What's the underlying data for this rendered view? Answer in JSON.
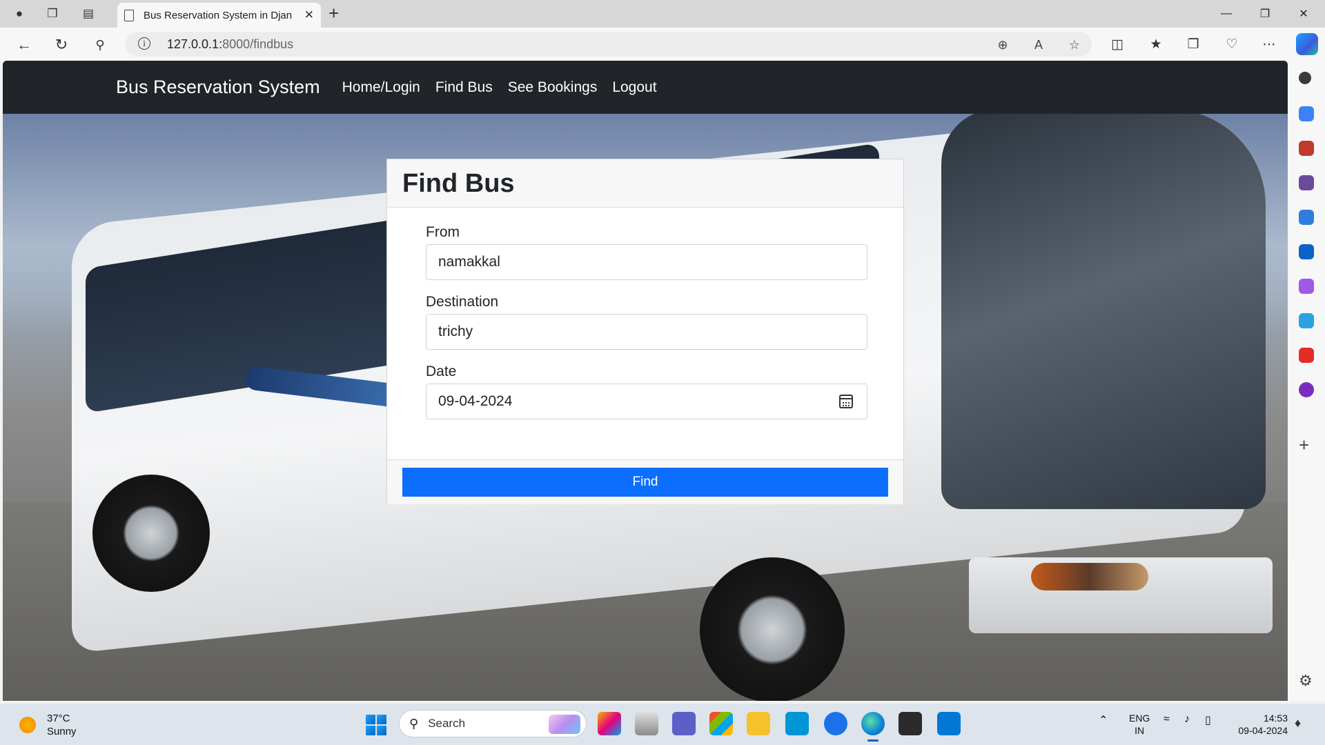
{
  "browser": {
    "tab_title": "Bus Reservation System in Django",
    "url_host": "127.0.0.1:",
    "url_path": "8000/findbus"
  },
  "site": {
    "brand": "Bus Reservation System",
    "nav": [
      "Home/Login",
      "Find Bus",
      "See Bookings",
      "Logout"
    ]
  },
  "form": {
    "title": "Find Bus",
    "from_label": "From",
    "from_value": "namakkal",
    "destination_label": "Destination",
    "destination_value": "trichy",
    "date_label": "Date",
    "date_value": "09-04-2024",
    "submit_label": "Find"
  },
  "taskbar": {
    "temperature": "37°C",
    "weather": "Sunny",
    "search_placeholder": "Search",
    "lang_line1": "ENG",
    "lang_line2": "IN",
    "time": "14:53",
    "date": "09-04-2024"
  },
  "colors": {
    "navbar": "#212529",
    "primary_button": "#0d6efd"
  }
}
